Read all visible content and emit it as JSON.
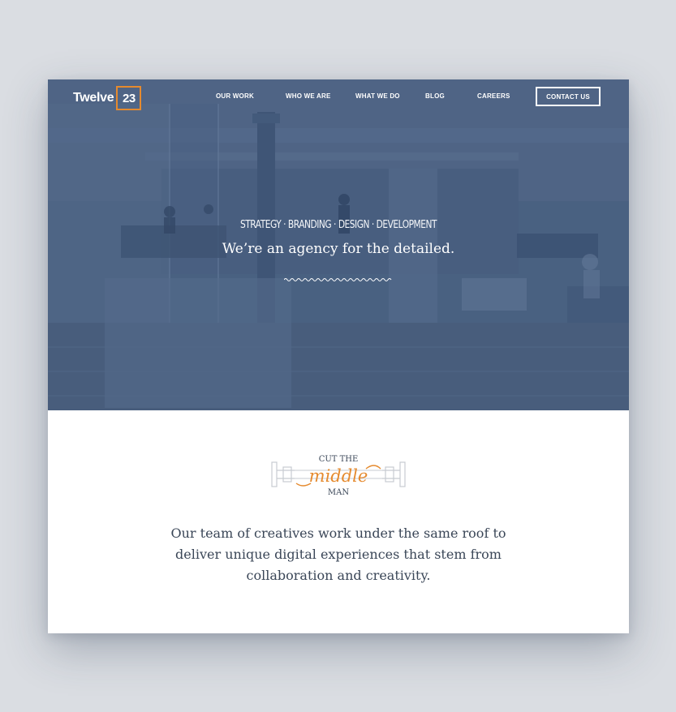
{
  "header": {
    "logo_word": "Twelve",
    "logo_number": "23",
    "nav": [
      {
        "label": "OUR WORK"
      },
      {
        "label": "WHO WE ARE"
      },
      {
        "label": "WHAT WE DO"
      },
      {
        "label": "BLOG"
      },
      {
        "label": "CAREERS"
      }
    ],
    "contact_label": "CONTACT US"
  },
  "hero": {
    "tagline": "STRATEGY · BRANDING · DESIGN · DEVELOPMENT",
    "headline": "We’re an agency for the detailed."
  },
  "badge": {
    "top": "CUT THE",
    "script": "middle",
    "bottom": "MAN"
  },
  "intro": {
    "text": "Our team of creatives work under the same roof to deliver unique digital experiences that stem from collaboration and creativity."
  },
  "colors": {
    "accent": "#e58a2e",
    "hero_tint": "#4d6484",
    "page_background": "#dadde2",
    "body_text": "#3a4657"
  },
  "icons": {
    "divider": "squiggle-divider-icon",
    "badge": "cut-the-middle-man-badge-icon"
  }
}
